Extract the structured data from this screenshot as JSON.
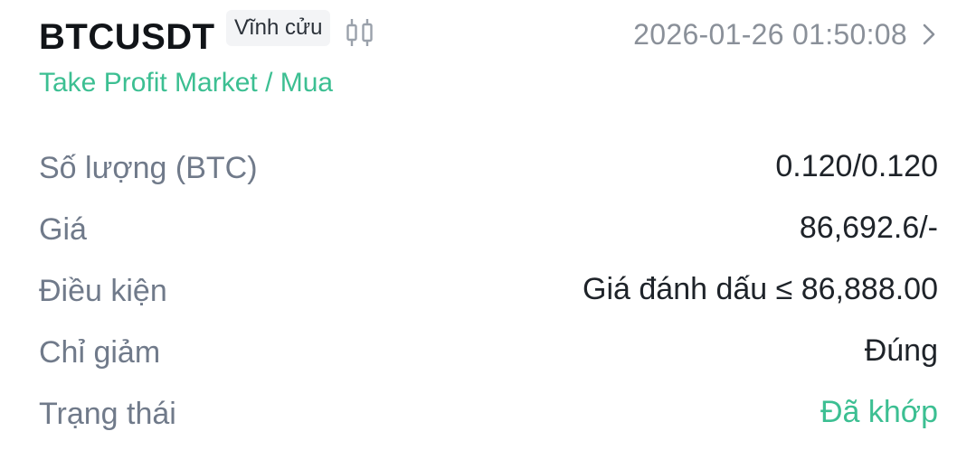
{
  "header": {
    "symbol": "BTCUSDT",
    "contract_tag": "Vĩnh cửu",
    "timestamp": "2026-01-26 01:50:08"
  },
  "order_type": "Take Profit Market / Mua",
  "details": [
    {
      "label": "Số lượng (BTC)",
      "value": "0.120/0.120"
    },
    {
      "label": "Giá",
      "value": "86,692.6/-"
    },
    {
      "label": "Điều kiện",
      "value": "Giá đánh dấu ≤ 86,888.00"
    },
    {
      "label": "Chỉ giảm",
      "value": "Đúng"
    },
    {
      "label": "Trạng thái",
      "value": "Đã khớp"
    }
  ],
  "colors": {
    "accent_green": "#3cbf92",
    "label_gray": "#707a8a",
    "value_dark": "#1e2329"
  },
  "icons": {
    "candlestick": "candlestick-chart-icon",
    "chevron": "chevron-right-icon"
  }
}
